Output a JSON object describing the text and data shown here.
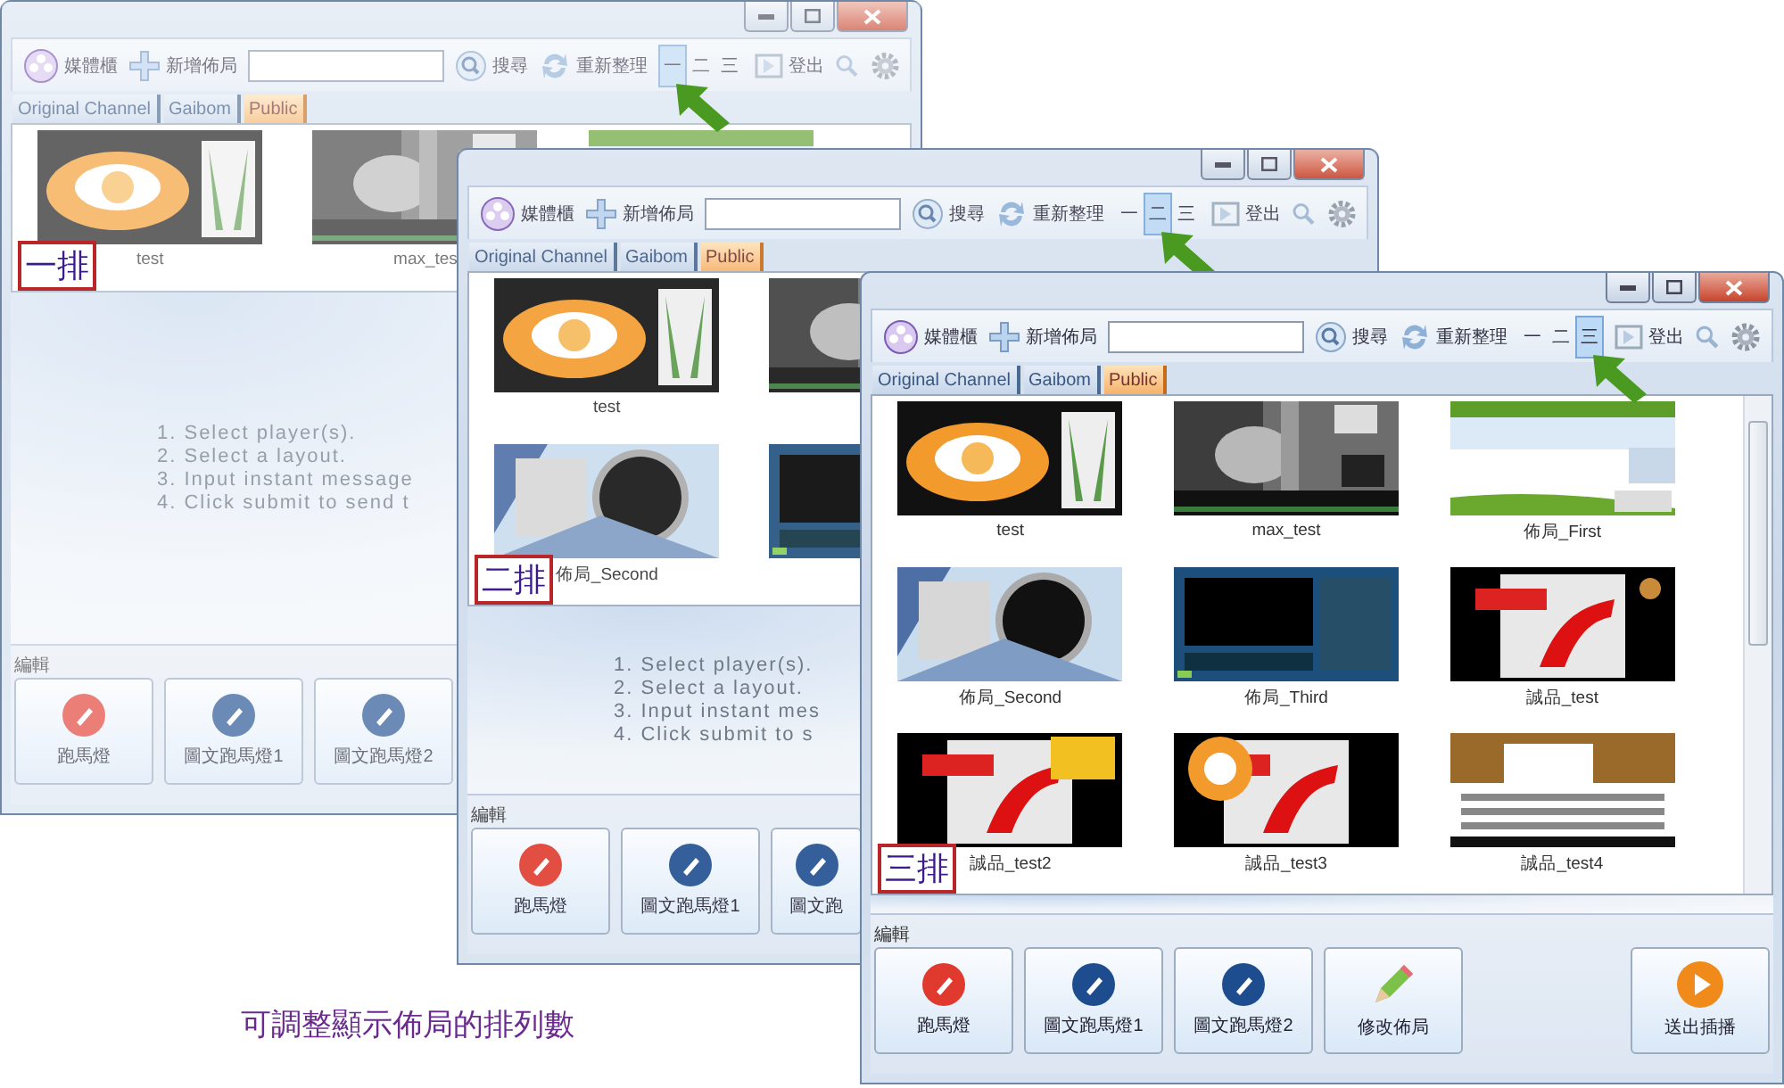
{
  "windows": [
    {
      "toolbar": {
        "media": "媒體櫃",
        "add": "新增佈局",
        "search": "搜尋",
        "refresh": "重新整理",
        "rows": [
          {
            "label": "一",
            "selected": true
          },
          {
            "label": "二",
            "selected": false
          },
          {
            "label": "三",
            "selected": false
          }
        ],
        "logout": "登出"
      },
      "tabs": [
        {
          "label": "Original Channel",
          "selected": false
        },
        {
          "label": "Gaibom",
          "selected": false
        },
        {
          "label": "Public",
          "selected": true
        }
      ],
      "rows": [
        [
          {
            "label": "test"
          },
          {
            "label": "max_tes"
          },
          {
            "kind": "picture"
          }
        ]
      ],
      "callout": "一排",
      "instructions": [
        "1.  Select player(s).",
        "2.  Select a layout.",
        "3.  Input instant message",
        "4.  Click submit to send t"
      ],
      "edit": {
        "title": "編輯",
        "buttons": [
          {
            "kind": "marquee",
            "label": "跑馬燈"
          },
          {
            "kind": "image-marquee",
            "label": "圖文跑馬燈1"
          },
          {
            "kind": "image-marquee",
            "label": "圖文跑馬燈2"
          }
        ]
      }
    },
    {
      "toolbar": {
        "media": "媒體櫃",
        "add": "新增佈局",
        "search": "搜尋",
        "refresh": "重新整理",
        "rows": [
          {
            "label": "一",
            "selected": false
          },
          {
            "label": "二",
            "selected": true
          },
          {
            "label": "三",
            "selected": false
          }
        ],
        "logout": "登出"
      },
      "tabs": [
        {
          "label": "Original Channel",
          "selected": false
        },
        {
          "label": "Gaibom",
          "selected": false
        },
        {
          "label": "Public",
          "selected": true
        }
      ],
      "rows": [
        [
          {
            "label": "test"
          },
          {
            "kind": "picture"
          }
        ],
        [
          {
            "label": "佈局_Second"
          },
          {
            "kind": "picture"
          }
        ]
      ],
      "callout": "二排",
      "instructions": [
        "1.  Select player(s).",
        "2.  Select a layout.",
        "3.  Input instant mes",
        "4.  Click submit to s"
      ],
      "edit": {
        "title": "編輯",
        "buttons": [
          {
            "kind": "marquee",
            "label": "跑馬燈"
          },
          {
            "kind": "image-marquee",
            "label": "圖文跑馬燈1"
          },
          {
            "kind": "image-marquee",
            "label": "圖文跑"
          }
        ]
      }
    },
    {
      "toolbar": {
        "media": "媒體櫃",
        "add": "新增佈局",
        "search": "搜尋",
        "refresh": "重新整理",
        "rows": [
          {
            "label": "一",
            "selected": false
          },
          {
            "label": "二",
            "selected": false
          },
          {
            "label": "三",
            "selected": true
          }
        ],
        "logout": "登出"
      },
      "tabs": [
        {
          "label": "Original Channel",
          "selected": false
        },
        {
          "label": "Gaibom",
          "selected": false
        },
        {
          "label": "Public",
          "selected": true
        }
      ],
      "rows": [
        [
          {
            "label": "test"
          },
          {
            "label": "max_test"
          },
          {
            "label": "佈局_First"
          }
        ],
        [
          {
            "label": "佈局_Second"
          },
          {
            "label": "佈局_Third"
          },
          {
            "label": "誠品_test"
          }
        ],
        [
          {
            "label": "誠品_test2"
          },
          {
            "label": "誠品_test3"
          },
          {
            "label": "誠品_test4"
          }
        ]
      ],
      "callout": "三排",
      "edit": {
        "title": "編輯",
        "buttons": [
          {
            "kind": "marquee",
            "label": "跑馬燈"
          },
          {
            "kind": "image-marquee",
            "label": "圖文跑馬燈1"
          },
          {
            "kind": "image-marquee",
            "label": "圖文跑馬燈2"
          },
          {
            "kind": "edit-layout",
            "label": "修改佈局"
          },
          {
            "kind": "send",
            "label": "送出插播"
          }
        ]
      }
    }
  ],
  "caption": "可調整顯示佈局的排列數"
}
